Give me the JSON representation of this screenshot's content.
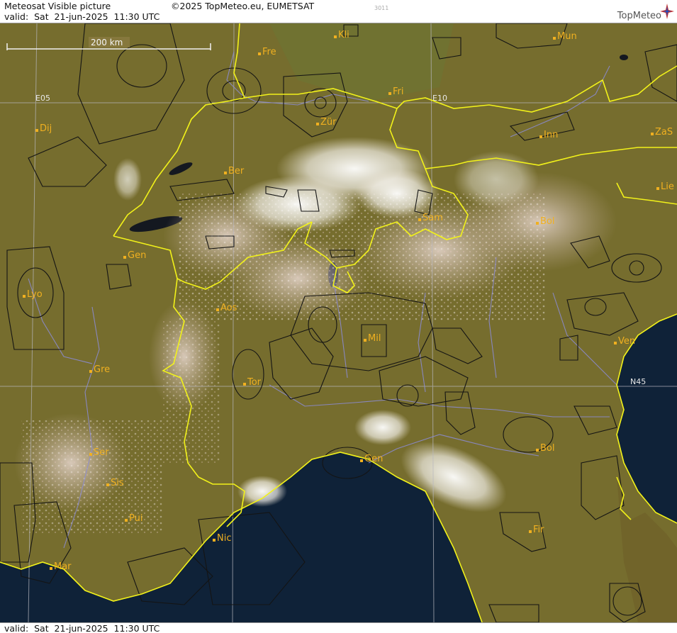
{
  "header": {
    "title": "Meteosat Visible picture",
    "valid_line": "valid:  Sat  21-jun-2025  11:30 UTC",
    "copyright": "©2025 TopMeteo.eu, EUMETSAT",
    "code": "3011",
    "logo_text": "TopMeteo"
  },
  "footer": {
    "valid_line": "valid:  Sat  21-jun-2025  11:30 UTC"
  },
  "scale_bar": {
    "label": "200 km"
  },
  "grid_labels": {
    "lon1": "E05",
    "lon2": "E10",
    "lat1": "N45"
  },
  "cities": [
    {
      "name": "Kli"
    },
    {
      "name": "Mun"
    },
    {
      "name": "Fre"
    },
    {
      "name": "Fri"
    },
    {
      "name": "Dij"
    },
    {
      "name": "Zür"
    },
    {
      "name": "Inn"
    },
    {
      "name": "ZaS"
    },
    {
      "name": "Ber"
    },
    {
      "name": "Lie"
    },
    {
      "name": "Sam"
    },
    {
      "name": "Bol"
    },
    {
      "name": "Gen"
    },
    {
      "name": "Lyo"
    },
    {
      "name": "Aos"
    },
    {
      "name": "Mil"
    },
    {
      "name": "Ven"
    },
    {
      "name": "Gre"
    },
    {
      "name": "Tor"
    },
    {
      "name": "Ser"
    },
    {
      "name": "Gen"
    },
    {
      "name": "Bol"
    },
    {
      "name": "Sis"
    },
    {
      "name": "Pui"
    },
    {
      "name": "Nic"
    },
    {
      "name": "Fir"
    },
    {
      "name": "Mar"
    }
  ],
  "colors": {
    "land": "#7a6a2c",
    "sea": "#0f2238",
    "cloud": "#f2f2f0",
    "border": "#f0f020",
    "river": "#9090d8",
    "airspace": "#111111",
    "city_label": "#f0b020"
  }
}
